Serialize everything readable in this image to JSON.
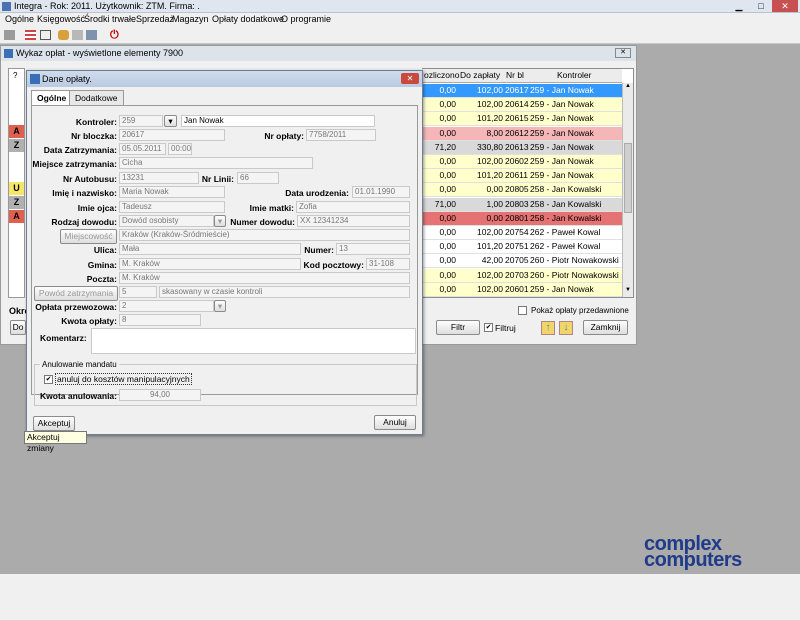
{
  "window": {
    "title": "Integra - Rok: 2011. Użytkownik: ZTM. Firma: ."
  },
  "menu": [
    "Ogólne",
    "Księgowość",
    "Środki trwałe",
    "Sprzedaż",
    "Magazyn",
    "Opłaty dodatkowe",
    "O programie"
  ],
  "list_window": {
    "title": "Wykaz opłat - wyświetlone elementy 7900",
    "header_q": "?",
    "columns": [
      "ozliczono",
      "Do zapłaty",
      "Nr bl",
      "Kontroler"
    ],
    "left_marks": [
      "A",
      "Z",
      "",
      "",
      "U",
      "Z",
      "A"
    ],
    "rows": [
      {
        "rozl": "0,00",
        "doz": "102,00",
        "nrbl": "20617",
        "kontroler": "259 - Jan Nowak",
        "style": "selected"
      },
      {
        "rozl": "0,00",
        "doz": "102,00",
        "nrbl": "20614",
        "kontroler": "259 - Jan Nowak",
        "style": "yellow"
      },
      {
        "rozl": "0,00",
        "doz": "101,20",
        "nrbl": "20615",
        "kontroler": "259 - Jan Nowak",
        "style": "yellow"
      },
      {
        "rozl": "0,00",
        "doz": "8,00",
        "nrbl": "20612",
        "kontroler": "259 - Jan Nowak",
        "style": "pink"
      },
      {
        "rozl": "71,20",
        "doz": "330,80",
        "nrbl": "20613",
        "kontroler": "259 - Jan Nowak",
        "style": "gray"
      },
      {
        "rozl": "0,00",
        "doz": "102,00",
        "nrbl": "20602",
        "kontroler": "259 - Jan Nowak",
        "style": "yellow"
      },
      {
        "rozl": "0,00",
        "doz": "101,20",
        "nrbl": "20611",
        "kontroler": "259 - Jan Nowak",
        "style": "yellow"
      },
      {
        "rozl": "0,00",
        "doz": "0,00",
        "nrbl": "20805",
        "kontroler": "258 - Jan Kowalski",
        "style": "yellow"
      },
      {
        "rozl": "71,00",
        "doz": "1,00",
        "nrbl": "20803",
        "kontroler": "258 - Jan Kowalski",
        "style": "gray"
      },
      {
        "rozl": "0,00",
        "doz": "0,00",
        "nrbl": "20801",
        "kontroler": "258 - Jan Kowalski",
        "style": "red"
      },
      {
        "rozl": "0,00",
        "doz": "102,00",
        "nrbl": "20754",
        "kontroler": "262 - Paweł Kowal",
        "style": "white"
      },
      {
        "rozl": "0,00",
        "doz": "101,20",
        "nrbl": "20751",
        "kontroler": "262 - Paweł Kowal",
        "style": "white"
      },
      {
        "rozl": "0,00",
        "doz": "42,00",
        "nrbl": "20705",
        "kontroler": "260 - Piotr Nowakowski",
        "style": "white"
      },
      {
        "rozl": "0,00",
        "doz": "102,00",
        "nrbl": "20703",
        "kontroler": "260 - Piotr Nowakowski",
        "style": "yellow"
      },
      {
        "rozl": "0,00",
        "doz": "102,00",
        "nrbl": "20601",
        "kontroler": "259 - Jan Nowak",
        "style": "yellow"
      }
    ],
    "show_overdue": "Pokaż opłaty przedawnione",
    "filter_btn": "Filtr",
    "filter_check": "Filtruj",
    "close_btn": "Zamknij",
    "left_label_okr": "Okre",
    "left_btn_do": "Do"
  },
  "dialog": {
    "title": "Dane opłaty.",
    "tabs": [
      "Ogólne",
      "Dodatkowe"
    ],
    "labels": {
      "kontroler": "Kontroler:",
      "nr_bloczka": "Nr bloczka:",
      "nr_oplaty": "Nr opłaty:",
      "data_zatrzymania": "Data Zatrzymania:",
      "miejsce": "Miejsce zatrzymania:",
      "nr_autobusu": "Nr Autobusu:",
      "nr_linii": "Nr Linii:",
      "imie_nazwisko": "Imię i nazwisko:",
      "data_urodzenia": "Data urodzenia:",
      "imie_ojca": "Imie ojca:",
      "imie_matki": "Imie matki:",
      "rodzaj_dowodu": "Rodzaj dowodu:",
      "numer_dowodu": "Numer dowodu:",
      "miejscowosc": "Miejscowość",
      "ulica": "Ulica:",
      "numer": "Numer:",
      "gmina": "Gmina:",
      "kod": "Kod pocztowy:",
      "poczta": "Poczta:",
      "powod": "Powód zatrzymania",
      "oplata_przewozowa": "Opłata przewozowa:",
      "kwota_oplaty": "Kwota opłaty:",
      "komentarz": "Komentarz:",
      "anulowanie_group": "Anulowanie mandatu",
      "anuluj_koszty": "anuluj do kosztów manipulacyjnych",
      "kwota_anulowania": "Kwota anulowania:"
    },
    "values": {
      "kontroler_id": "259",
      "kontroler_name": "Jan Nowak",
      "nr_bloczka": "20617",
      "nr_oplaty": "7758/2011",
      "data": "05.05.2011",
      "godzina": "00:00",
      "miejsce": "Cicha",
      "nr_autobusu": "13231",
      "nr_linii": "66",
      "imie_nazwisko": "Maria Nowak",
      "data_urodzenia": "01.01.1990",
      "imie_ojca": "Tadeusz",
      "imie_matki": "Zofia",
      "rodzaj_dowodu": "Dowód osobisty",
      "numer_dowodu": "XX 12341234",
      "miejscowosc": "Kraków (Kraków-Śródmieście)",
      "ulica": "Mała",
      "numer": "13",
      "gmina": "M. Kraków",
      "kod": "31-108",
      "poczta": "M. Kraków",
      "powod_kod": "5",
      "powod_opis": "skasowany w czasie kontroli",
      "oplata_przewozowa": "2",
      "kwota_oplaty": "8",
      "komentarz": "",
      "kwota_anulowania": "94,00"
    },
    "buttons": {
      "akceptuj": "Akceptuj",
      "anuluj": "Anuluj"
    },
    "tooltip": "Akceptuj zmiany"
  },
  "logo": {
    "line1": "complex",
    "line2": "computers"
  },
  "colors": {
    "selected": "#3399ff",
    "yellow": "#ffffcc",
    "pink": "#f4b6b6",
    "red": "#e57373",
    "gray": "#d9d9d9",
    "white": "#ffffff",
    "mark_A": "#e06050",
    "mark_Z": "#b0b0b0",
    "mark_U": "#f5e66a"
  }
}
